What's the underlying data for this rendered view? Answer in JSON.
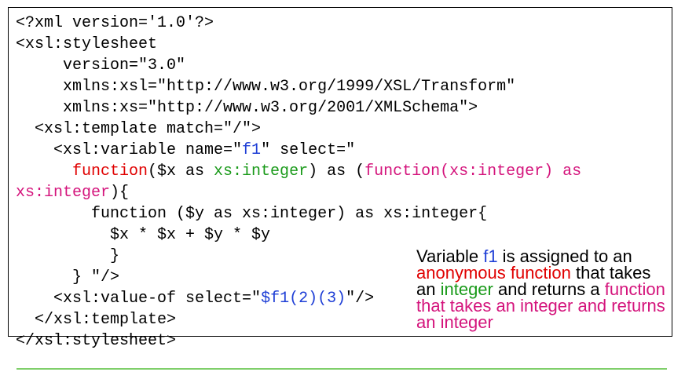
{
  "code_lines": [
    [
      {
        "t": "<?xml version='1.0'?>",
        "c": ""
      }
    ],
    [
      {
        "t": "<xsl:stylesheet",
        "c": ""
      }
    ],
    [
      {
        "t": "     version=\"3.0\"",
        "c": ""
      }
    ],
    [
      {
        "t": "     xmlns:xsl=\"http://www.w3.org/1999/XSL/Transform\"",
        "c": ""
      }
    ],
    [
      {
        "t": "     xmlns:xs=\"http://www.w3.org/2001/XMLSchema\">",
        "c": ""
      }
    ],
    [
      {
        "t": "  <xsl:template match=\"/\">",
        "c": ""
      }
    ],
    [
      {
        "t": "    <xsl:variable name=\"",
        "c": ""
      },
      {
        "t": "f1",
        "c": "blue"
      },
      {
        "t": "\" select=\"",
        "c": ""
      }
    ],
    [
      {
        "t": "      ",
        "c": ""
      },
      {
        "t": "function",
        "c": "red"
      },
      {
        "t": "($x as ",
        "c": ""
      },
      {
        "t": "xs:integer",
        "c": "green"
      },
      {
        "t": ") as (",
        "c": ""
      },
      {
        "t": "function(xs:integer) as",
        "c": "magenta"
      }
    ],
    [
      {
        "t": "xs:integer",
        "c": "magenta"
      },
      {
        "t": "){",
        "c": ""
      }
    ],
    [
      {
        "t": "        function ($y as xs:integer) as xs:integer{",
        "c": ""
      }
    ],
    [
      {
        "t": "          $x * $x + $y * $y",
        "c": ""
      }
    ],
    [
      {
        "t": "          }",
        "c": ""
      }
    ],
    [
      {
        "t": "      } \"/>",
        "c": ""
      }
    ],
    [
      {
        "t": "    <xsl:value-of select=\"",
        "c": ""
      },
      {
        "t": "$f1(2)(3)",
        "c": "blue"
      },
      {
        "t": "\"/>",
        "c": ""
      }
    ],
    [
      {
        "t": "  </xsl:template>",
        "c": ""
      }
    ],
    [
      {
        "t": "</xsl:stylesheet>",
        "c": ""
      }
    ]
  ],
  "annotation": {
    "segments": [
      {
        "t": "Variable ",
        "c": ""
      },
      {
        "t": "f1",
        "c": "blue"
      },
      {
        "t": " is assigned to an ",
        "c": ""
      },
      {
        "t": "anonymous function",
        "c": "red"
      },
      {
        "t": " that takes an ",
        "c": ""
      },
      {
        "t": "integer",
        "c": "green"
      },
      {
        "t": " and returns a ",
        "c": ""
      },
      {
        "t": "function that takes an integer and returns an integer",
        "c": "magenta"
      }
    ]
  },
  "colors": {
    "blue": "#1f3fd6",
    "red": "#e00000",
    "green": "#1a9a1a",
    "magenta": "#d4147c",
    "divider": "#7fcf6a"
  }
}
